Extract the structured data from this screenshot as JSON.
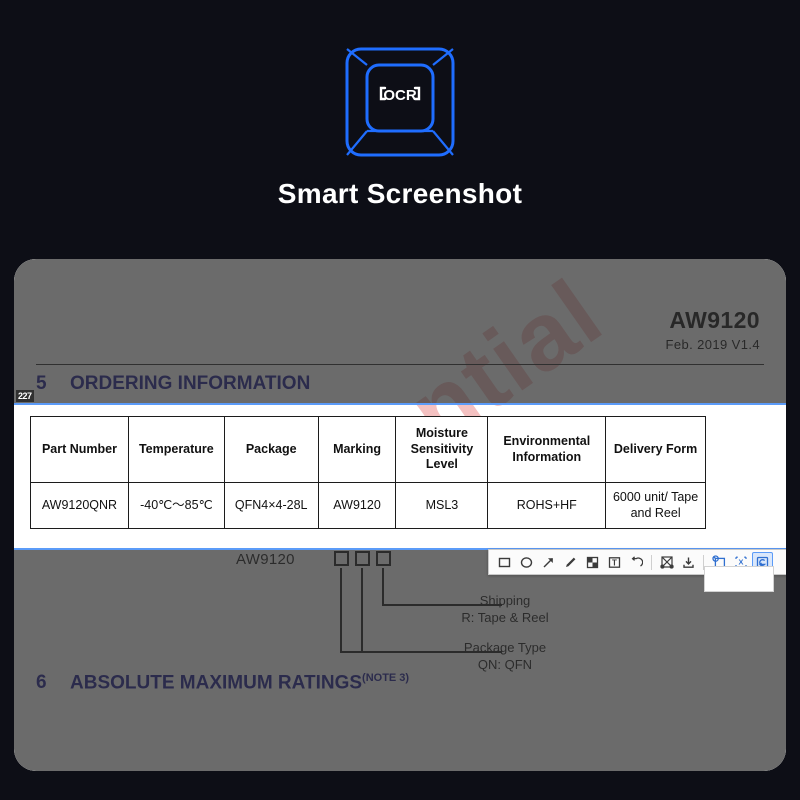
{
  "app": {
    "title": "Smart Screenshot",
    "logo_icon": "ocr-keycap-icon",
    "logo_text": "OCR",
    "accent_color": "#1f6dff",
    "background_color": "#0d0e16"
  },
  "document": {
    "part_name": "AW9120",
    "revision": "Feb. 2019 V1.4",
    "watermark": "ential",
    "selection_badge": "227",
    "sections": [
      {
        "number": "5",
        "title": "ORDERING INFORMATION",
        "note": ""
      },
      {
        "number": "6",
        "title": "ABSOLUTE MAXIMUM RATINGS",
        "note": "(NOTE 3)"
      }
    ],
    "ordering_table": {
      "headers": [
        "Part Number",
        "Temperature",
        "Package",
        "Marking",
        "Moisture Sensitivity Level",
        "Environmental Information",
        "Delivery Form"
      ],
      "rows": [
        [
          "AW9120QNR",
          "-40℃～85℃",
          "QFN4×4-28L",
          "AW9120",
          "MSL3",
          "ROHS+HF",
          "6000 unit/ Tape and Reel"
        ]
      ]
    },
    "part_decode": {
      "base": "AW9120",
      "callouts": [
        {
          "title": "Shipping",
          "detail": "R: Tape & Reel"
        },
        {
          "title": "Package Type",
          "detail": "QN: QFN"
        }
      ]
    }
  },
  "toolbar": {
    "tools": [
      {
        "name": "rectangle-tool",
        "icon": "rectangle-icon",
        "active": false
      },
      {
        "name": "ellipse-tool",
        "icon": "ellipse-icon",
        "active": false
      },
      {
        "name": "arrow-tool",
        "icon": "arrow-icon",
        "active": false
      },
      {
        "name": "pencil-tool",
        "icon": "pencil-icon",
        "active": false
      },
      {
        "name": "mosaic-tool",
        "icon": "mosaic-icon",
        "active": false
      },
      {
        "name": "text-tool",
        "icon": "text-icon",
        "active": false
      },
      {
        "name": "undo-tool",
        "icon": "undo-icon",
        "active": false
      },
      {
        "name": "crop-tool",
        "icon": "scissors-icon",
        "active": false
      },
      {
        "name": "save-tool",
        "icon": "download-icon",
        "active": false
      },
      {
        "name": "pin-tool",
        "icon": "pin-icon",
        "active": false
      },
      {
        "name": "translate-tool",
        "icon": "translate-icon",
        "active": false
      },
      {
        "name": "ocr-tool",
        "icon": "ocr-icon",
        "active": true
      }
    ],
    "cancel_label": "✕",
    "confirm_label": "✓"
  }
}
